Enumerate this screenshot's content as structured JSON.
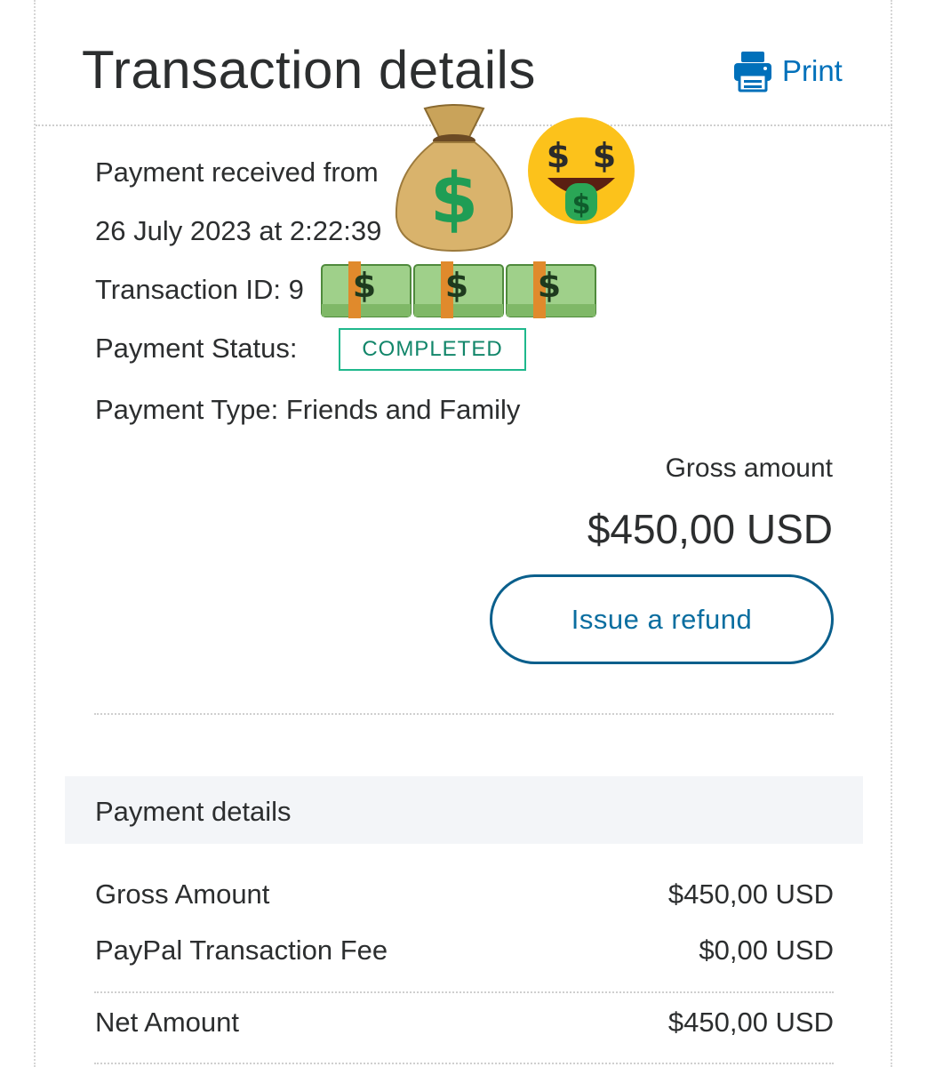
{
  "header": {
    "title": "Transaction details",
    "print_label": "Print",
    "print_icon": "printer-icon"
  },
  "transaction": {
    "received_line": "Payment received from",
    "date_line": "26 July 2023 at 2:22:39",
    "id_label": "Transaction ID: 9",
    "status_label": "Payment Status:",
    "status_value": "COMPLETED",
    "type_line": "Payment Type: Friends and Family"
  },
  "amount": {
    "gross_label": "Gross amount",
    "gross_value": "$450,00 USD",
    "refund_button": "Issue a refund"
  },
  "payment_details": {
    "title": "Payment details",
    "rows": [
      {
        "label": "Gross Amount",
        "value": "$450,00 USD"
      },
      {
        "label": "PayPal Transaction Fee",
        "value": "$0,00 USD"
      },
      {
        "label": "Net Amount",
        "value": "$450,00 USD"
      }
    ]
  },
  "overlays": {
    "stickers": [
      "money-bag-icon",
      "money-mouth-face-icon",
      "dollar-banknote-stack-icon",
      "dollar-banknote-stack-icon",
      "dollar-banknote-stack-icon"
    ]
  },
  "colors": {
    "accent": "#0070ba",
    "status_green": "#1fb88c",
    "section_bg": "#f3f5f8",
    "text": "#2c2e2f"
  }
}
